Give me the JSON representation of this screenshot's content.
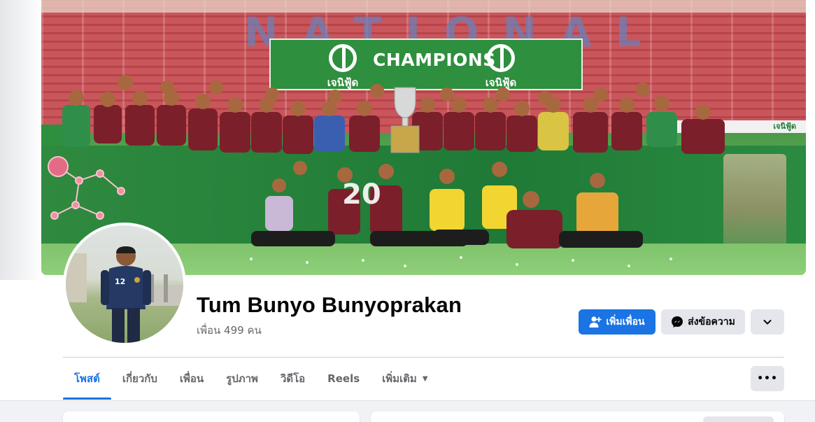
{
  "profile": {
    "name": "Tum Bunyo Bunyoprakan",
    "friends_count": "เพื่อน 499 คน"
  },
  "cover_photo": {
    "banner_title": "CHAMPIONS",
    "brand_text": "เจนิฟู้ด",
    "stadium_text": "NATIONAL",
    "player_jersey_number": "12"
  },
  "actions": {
    "add_friend_label": "เพิ่มเพื่อน",
    "message_label": "ส่งข้อความ"
  },
  "tabs": [
    {
      "label": "โพสต์",
      "active": true
    },
    {
      "label": "เกี่ยวกับ",
      "active": false
    },
    {
      "label": "เพื่อน",
      "active": false
    },
    {
      "label": "รูปภาพ",
      "active": false
    },
    {
      "label": "วิดีโอ",
      "active": false
    },
    {
      "label": "Reels",
      "active": false
    },
    {
      "label": "เพิ่มเติม",
      "active": false
    }
  ],
  "colors": {
    "primary_blue": "#1b74e4",
    "secondary_gray": "#e4e6eb",
    "text_dark": "#050505",
    "text_muted": "#65676b",
    "banner_green": "#2e8f3e",
    "jersey_maroon": "#7b1f2b"
  },
  "icons": {
    "add_friend": "person-plus-icon",
    "message": "messenger-icon",
    "more_profile": "chevron-down-icon",
    "more_tab": "caret-down-icon",
    "overflow": "ellipsis-icon"
  }
}
